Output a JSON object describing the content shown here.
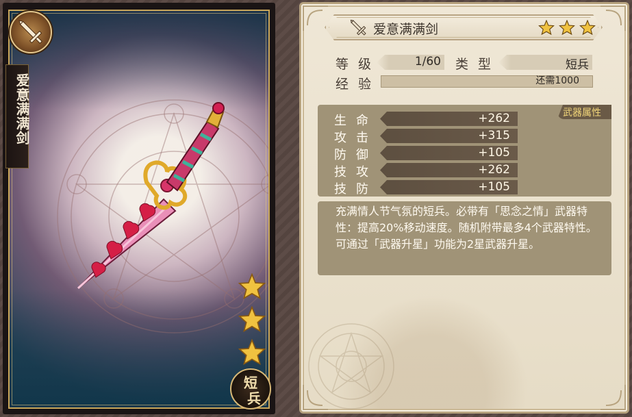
{
  "weapon": {
    "name": "爱意满满剑",
    "stars": 3,
    "type_badge": [
      "短",
      "兵"
    ]
  },
  "info": {
    "level_label": "等级",
    "level_value": "1/60",
    "type_label": "类型",
    "type_value": "短兵",
    "exp_label": "经验",
    "exp_text": "还需1000",
    "exp_progress": 0
  },
  "attributes": {
    "tag": "武器属性",
    "items": [
      {
        "label": "生命",
        "value": "+262"
      },
      {
        "label": "攻击",
        "value": "+315"
      },
      {
        "label": "防御",
        "value": "+105"
      },
      {
        "label": "技攻",
        "value": "+262"
      },
      {
        "label": "技防",
        "value": "+105"
      }
    ]
  },
  "description": "充满情人节气氛的短兵。必带有「思念之情」武器特性：提高20%移动速度。随机附带最多4个武器特性。可通过「武器升星」功能为2星武器升星。",
  "colors": {
    "gold": "#c9a65a",
    "star": "#f0c240",
    "panel_bg": "#efe7d6",
    "attr_box": "#a09377"
  },
  "icons": {
    "card_corner": "sword-icon",
    "title": "sword-icon",
    "star": "star-icon"
  }
}
